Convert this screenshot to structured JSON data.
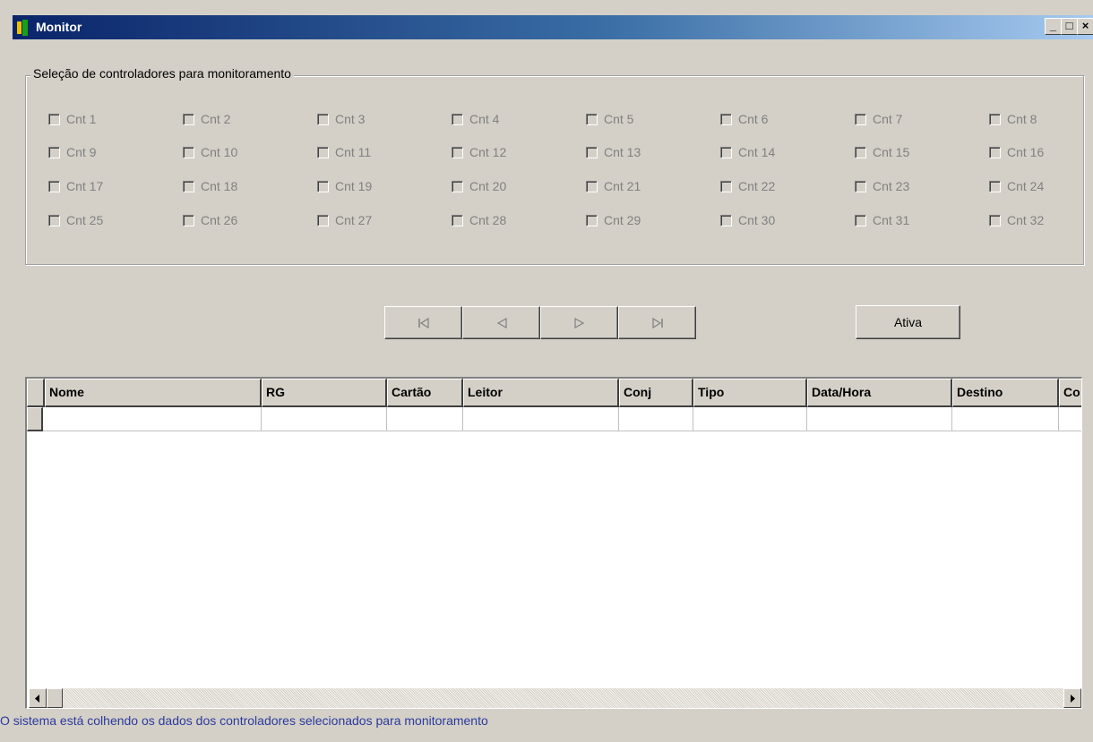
{
  "window": {
    "title": "Monitor",
    "minimize_label": "_",
    "maximize_label": "□",
    "close_label": "×"
  },
  "selection_group": {
    "legend": "Seleção de controladores para monitoramento",
    "controllers": [
      "Cnt 1",
      "Cnt 2",
      "Cnt 3",
      "Cnt 4",
      "Cnt 5",
      "Cnt 6",
      "Cnt 7",
      "Cnt 8",
      "Cnt 9",
      "Cnt 10",
      "Cnt 11",
      "Cnt 12",
      "Cnt 13",
      "Cnt 14",
      "Cnt 15",
      "Cnt 16",
      "Cnt 17",
      "Cnt 18",
      "Cnt 19",
      "Cnt 20",
      "Cnt 21",
      "Cnt 22",
      "Cnt 23",
      "Cnt 24",
      "Cnt 25",
      "Cnt 26",
      "Cnt 27",
      "Cnt 28",
      "Cnt 29",
      "Cnt 30",
      "Cnt 31",
      "Cnt 32"
    ]
  },
  "navigation": {
    "first": "⏮",
    "prev": "◁",
    "next": "▷",
    "last": "⏭"
  },
  "ativa_button": "Ativa",
  "grid": {
    "columns": [
      "Nome",
      "RG",
      "Cartão",
      "Leitor",
      "Conj",
      "Tipo",
      "Data/Hora",
      "Destino",
      "Co"
    ]
  },
  "status_text": "O sistema está colhendo os dados dos controladores selecionados para monitoramento"
}
